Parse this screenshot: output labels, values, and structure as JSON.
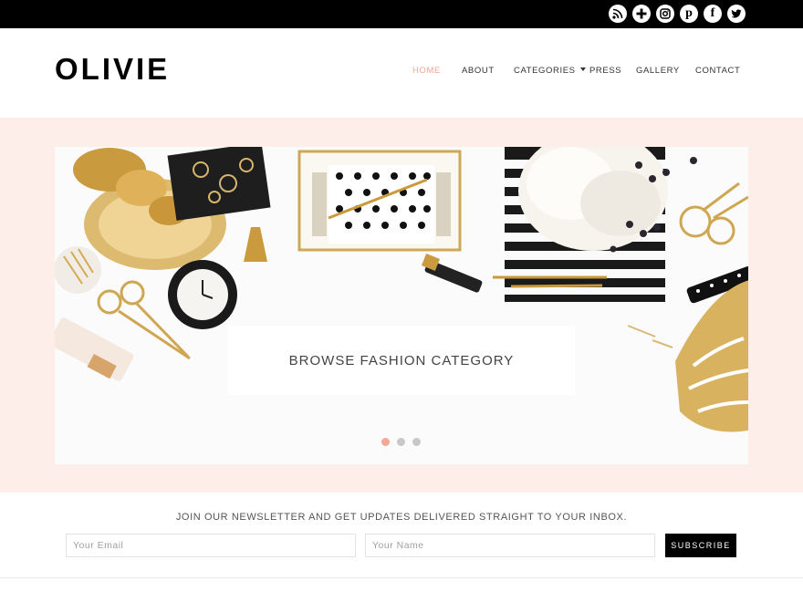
{
  "social": {
    "icons": [
      "rss-icon",
      "plus-icon",
      "instagram-icon",
      "pinterest-icon",
      "facebook-icon",
      "twitter-icon"
    ],
    "bg": "#000000"
  },
  "header": {
    "logo": "OLIVIE",
    "nav": [
      {
        "label": "HOME",
        "active": true
      },
      {
        "label": "ABOUT"
      },
      {
        "label": "CATEGORIES",
        "has_dropdown": true
      },
      {
        "label": "PRESS"
      },
      {
        "label": "GALLERY"
      },
      {
        "label": "CONTACT"
      }
    ]
  },
  "hero": {
    "caption": "BROWSE FASHION CATEGORY",
    "slides": 3,
    "active_slide": 1,
    "band_color": "#fdeeea",
    "accent": "#f3a89a"
  },
  "newsletter": {
    "text": "JOIN OUR NEWSLETTER AND GET UPDATES DELIVERED STRAIGHT TO YOUR INBOX.",
    "email_placeholder": "Your Email",
    "name_placeholder": "Your Name",
    "button": "SUBSCRIBE"
  }
}
